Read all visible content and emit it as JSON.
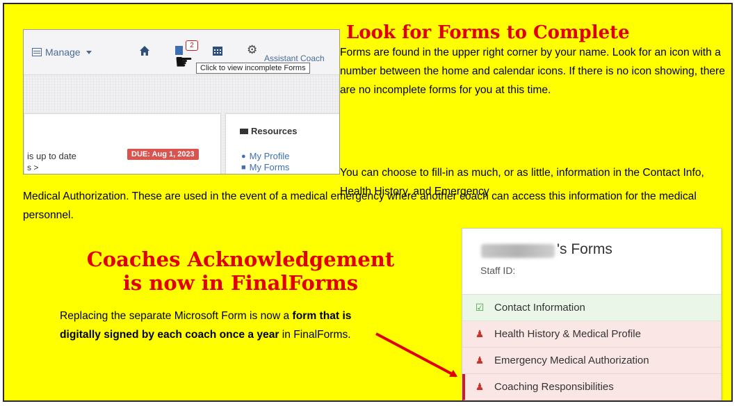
{
  "screenshot": {
    "manage_label": "Manage",
    "forms_badge_count": "2",
    "assistant_coach": "Assistant Coach",
    "tooltip": "Click to view incomplete Forms",
    "resources_title": "Resources",
    "resources_links": [
      "My Profile",
      "My Forms"
    ],
    "status_text": "is up to date",
    "status_more": "s >",
    "due_badge": "DUE: Aug 1, 2023"
  },
  "heading_top": "Look for Forms to Complete",
  "para_1": "Forms are found in the upper right corner by your name. Look for an icon with a number between the home and calendar icons. If there is no icon showing, there are no incomplete forms for you at this time.",
  "para_2": "You can choose to fill-in as much, or as little, information in the Contact Info, Health History, and Emergency",
  "para_3": "Medical Authorization. These are used in the event of a medical emergency where another coach can access this information for the medical personnel.",
  "heading_bottom_line1": "Coaches Acknowledgement",
  "heading_bottom_line2": "is now in FinalForms",
  "para_4": {
    "before": "Replacing the separate Microsoft Form is now a ",
    "bold": "form that is digitally signed by each coach once a year",
    "after": " in FinalForms."
  },
  "forms_panel": {
    "title_suffix": "'s Forms",
    "staff_id_label": "Staff ID:",
    "items": [
      {
        "label": "Contact Information",
        "status": "complete"
      },
      {
        "label": "Health History & Medical Profile",
        "status": "incomplete"
      },
      {
        "label": "Emergency Medical Authorization",
        "status": "incomplete"
      },
      {
        "label": "Coaching Responsibilities",
        "status": "incomplete"
      }
    ]
  },
  "colors": {
    "background": "#ffff00",
    "heading_red": "#e00000",
    "complete_green": "#3fa33a",
    "incomplete_red": "#c8332f"
  }
}
